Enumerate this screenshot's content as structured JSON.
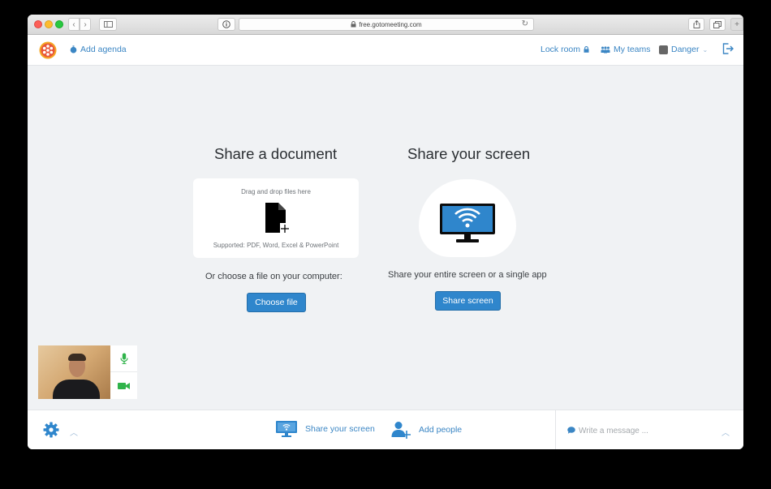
{
  "browser": {
    "url": "free.gotomeeting.com"
  },
  "header": {
    "add_agenda": "Add agenda",
    "lock_room": "Lock room",
    "my_teams": "My teams",
    "user_name": "Danger"
  },
  "document": {
    "title": "Share a document",
    "drag_drop": "Drag and drop files here",
    "supported": "Supported: PDF, Word, Excel & PowerPoint",
    "or_choose": "Or choose a file on your computer:",
    "choose_file": "Choose file"
  },
  "screen": {
    "title": "Share your screen",
    "description": "Share your entire screen or a single app",
    "button": "Share screen"
  },
  "bottombar": {
    "share_screen": "Share your screen",
    "add_people": "Add people",
    "chat_placeholder": "Write a message ..."
  },
  "colors": {
    "accent": "#2f86cc",
    "mic_green": "#2fb34a"
  }
}
